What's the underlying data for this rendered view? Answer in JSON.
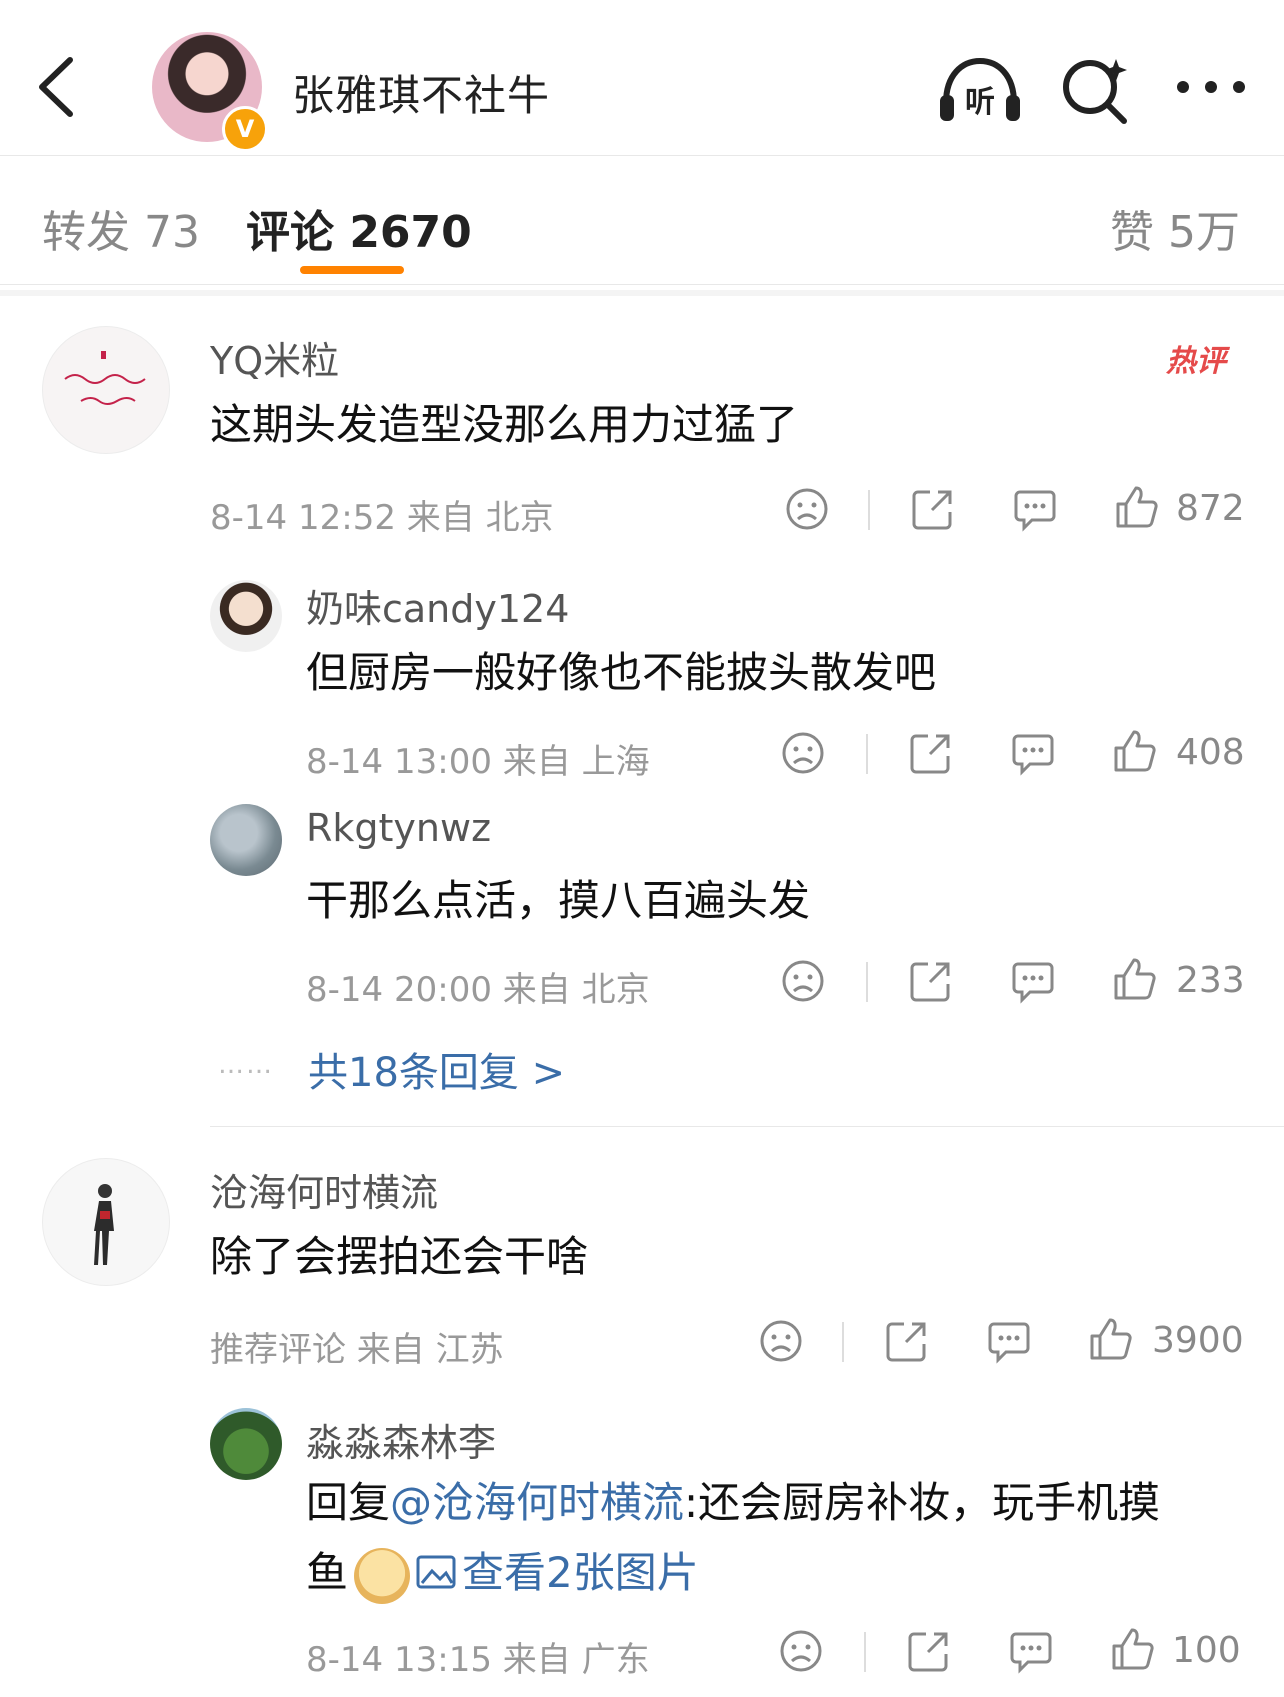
{
  "header": {
    "title": "张雅琪不社牛",
    "badge": "V",
    "listen_label": "听"
  },
  "tabs": {
    "repost": "转发 73",
    "comment": "评论 2670",
    "like": "赞 5万"
  },
  "comments": [
    {
      "name": "YQ米粒",
      "text": "这期头发造型没那么用力过猛了",
      "meta": "8-14 12:52  来自 北京",
      "likes": "872",
      "hot_label": "热评",
      "replies": [
        {
          "name": "奶味candy124",
          "text": "但厨房一般好像也不能披头散发吧",
          "meta": "8-14 13:00  来自 上海",
          "likes": "408"
        },
        {
          "name": "Rkgtynwz",
          "text": "干那么点活，摸八百遍头发",
          "meta": "8-14 20:00  来自 北京",
          "likes": "233"
        }
      ],
      "replies_link": "共18条回复 >",
      "replies_dots": "……"
    },
    {
      "name": "沧海何时横流",
      "text": "除了会摆拍还会干啥",
      "meta": "推荐评论  来自 江苏",
      "likes": "3900",
      "replies": [
        {
          "name": "淼淼森林李",
          "prefix": "回复",
          "mention": "@沧海何时横流",
          "text_line1": ":还会厨房补妆，玩手机摸",
          "text_line2": "鱼",
          "image_link": "查看2张图片",
          "meta": "8-14 13:15  来自 广东",
          "likes": "100"
        }
      ]
    }
  ]
}
